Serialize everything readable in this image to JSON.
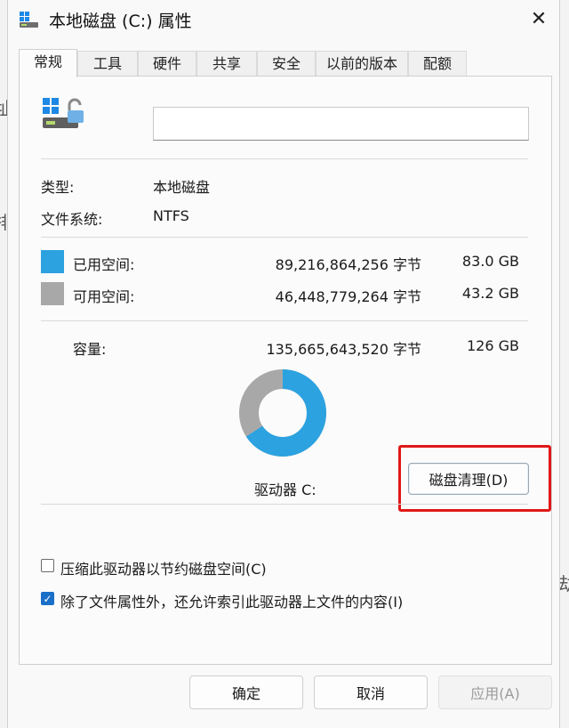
{
  "window": {
    "title": "本地磁盘 (C:) 属性",
    "close_label": "✕"
  },
  "tabs": [
    {
      "label": "常规",
      "active": true
    },
    {
      "label": "工具",
      "active": false
    },
    {
      "label": "硬件",
      "active": false
    },
    {
      "label": "共享",
      "active": false
    },
    {
      "label": "安全",
      "active": false
    },
    {
      "label": "以前的版本",
      "active": false
    },
    {
      "label": "配额",
      "active": false
    }
  ],
  "general": {
    "drive_name_value": "",
    "type_label": "类型:",
    "type_value": "本地磁盘",
    "fs_label": "文件系统:",
    "fs_value": "NTFS",
    "used": {
      "label": "已用空间:",
      "bytes": "89,216,864,256 字节",
      "size": "83.0 GB",
      "color": "#2ca2e0"
    },
    "free": {
      "label": "可用空间:",
      "bytes": "46,448,779,264 字节",
      "size": "43.2 GB",
      "color": "#a8a8a8"
    },
    "capacity": {
      "label": "容量:",
      "bytes": "135,665,643,520 字节",
      "size": "126 GB"
    },
    "used_fraction": 0.6576,
    "drive_label": "驱动器 C:",
    "cleanup_button": "磁盘清理(D)"
  },
  "options": {
    "compress_label": "压缩此驱动器以节约磁盘空间(C)",
    "compress_checked": false,
    "index_label": "除了文件属性外，还允许索引此驱动器上文件的内容(I)",
    "index_checked": true,
    "check_mark": "✓"
  },
  "footer": {
    "ok": "确定",
    "cancel": "取消",
    "apply": "应用(A)"
  },
  "background": {
    "glyph_left_1": "址",
    "glyph_left_2": "排",
    "glyph_right": "劫"
  }
}
